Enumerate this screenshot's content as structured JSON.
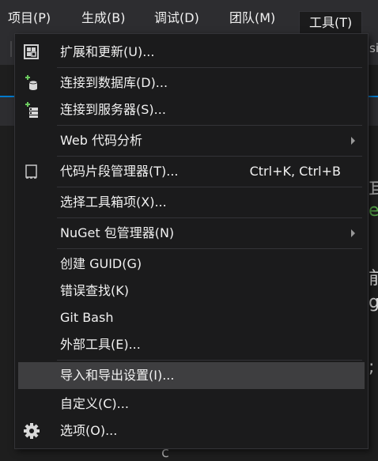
{
  "menubar": {
    "items": [
      {
        "label": "项目(P)",
        "active": false
      },
      {
        "label": "生成(B)",
        "active": false
      },
      {
        "label": "调试(D)",
        "active": false
      },
      {
        "label": "团队(M)",
        "active": false
      },
      {
        "label": "工具(T)",
        "active": true
      }
    ]
  },
  "background": {
    "toolbar_fragment": "si",
    "editor_glyphs": [
      "耳",
      "e",
      "前",
      "g",
      ";"
    ],
    "bottom_glyph": "c"
  },
  "tools_menu": {
    "items": [
      {
        "label": "扩展和更新(U)...",
        "icon": "extensions-icon"
      },
      {
        "label": "连接到数据库(D)...",
        "icon": "database-connect-icon"
      },
      {
        "label": "连接到服务器(S)...",
        "icon": "server-connect-icon"
      },
      {
        "label": "Web 代码分析",
        "submenu": true
      },
      {
        "label": "代码片段管理器(T)...",
        "icon": "snippet-icon",
        "shortcut": "Ctrl+K, Ctrl+B"
      },
      {
        "label": "选择工具箱项(X)..."
      },
      {
        "label": "NuGet 包管理器(N)",
        "submenu": true
      },
      {
        "label": "创建 GUID(G)"
      },
      {
        "label": "错误查找(K)"
      },
      {
        "label": "Git Bash"
      },
      {
        "label": "外部工具(E)..."
      },
      {
        "label": "导入和导出设置(I)...",
        "highlighted": true
      },
      {
        "label": "自定义(C)..."
      },
      {
        "label": "选项(O)...",
        "icon": "gear-icon"
      }
    ]
  },
  "colors": {
    "menubar_bg": "#2d2d30",
    "menu_bg": "#1b1b1c",
    "menu_border": "#333337",
    "highlight_bg": "#3e3e40",
    "text": "#f1f1f1",
    "accent_blue": "#007acc",
    "icon_green": "#6ccb5f"
  }
}
